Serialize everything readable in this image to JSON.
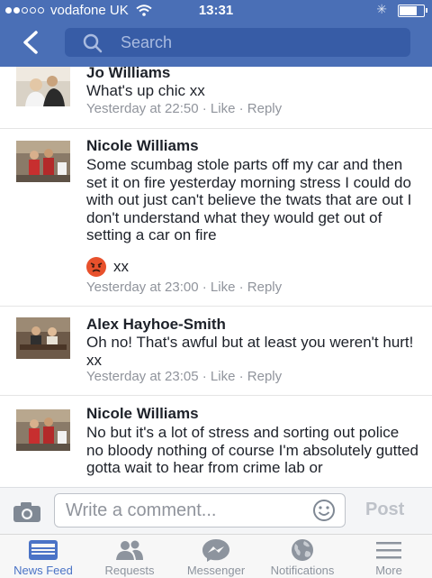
{
  "status_bar": {
    "carrier": "vodafone UK",
    "time": "13:31"
  },
  "header": {
    "search_placeholder": "Search"
  },
  "comments": [
    {
      "name": "Jo Williams",
      "text": "What's up chic xx",
      "time": "Yesterday at 22:50",
      "like": "Like",
      "reply": "Reply"
    },
    {
      "name": "Nicole Williams",
      "text": "Some scumbag stole parts off my car and then set it on fire yesterday morning stress I could do with out just can't believe the twats that are out I don't understand what they would get out of setting a car on fire",
      "suffix": "xx",
      "time": "Yesterday at 23:00",
      "like": "Like",
      "reply": "Reply"
    },
    {
      "name": "Alex Hayhoe-Smith",
      "text": "Oh no! That's awful but at least you weren't hurt! xx",
      "time": "Yesterday at 23:05",
      "like": "Like",
      "reply": "Reply"
    },
    {
      "name": "Nicole Williams",
      "text": "No but it's a lot of stress and sorting out police no bloody nothing of course I'm absolutely gutted gotta wait to hear from crime lab or"
    }
  ],
  "composer": {
    "placeholder": "Write a comment...",
    "post_label": "Post"
  },
  "tabs": [
    {
      "label": "News Feed",
      "icon": "news-feed-icon",
      "active": true
    },
    {
      "label": "Requests",
      "icon": "friend-requests-icon"
    },
    {
      "label": "Messenger",
      "icon": "messenger-icon"
    },
    {
      "label": "Notifications",
      "icon": "globe-icon"
    },
    {
      "label": "More",
      "icon": "menu-icon"
    }
  ],
  "colors": {
    "header": "#4a6fb6",
    "accent": "#4a73c6",
    "muted": "#90949c"
  }
}
